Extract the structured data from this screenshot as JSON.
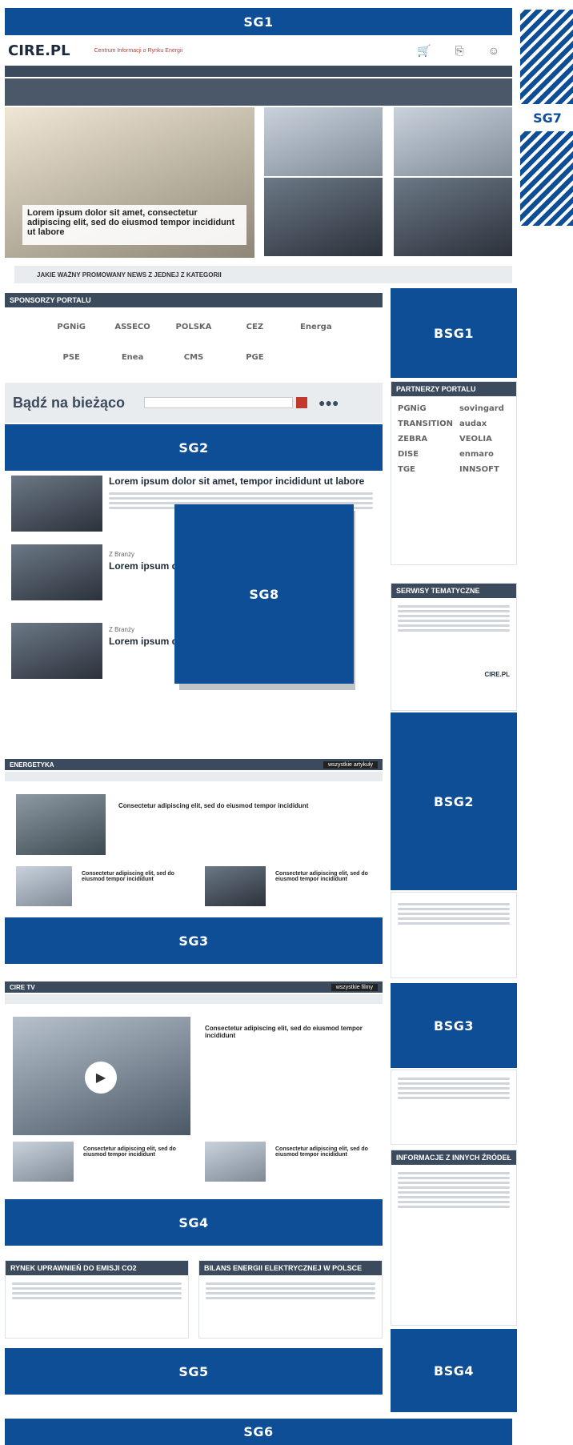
{
  "header": {
    "logo": "CIRE.PL",
    "tagline": "Centrum Informacji o Rynku Energii",
    "icons": [
      "cart-icon",
      "login-icon",
      "user-icon"
    ]
  },
  "placeholders": {
    "sg1": "SG1",
    "sg2": "SG2",
    "sg3": "SG3",
    "sg4": "SG4",
    "sg5": "SG5",
    "sg6": "SG6",
    "sg7": "SG7",
    "sg8": "SG8",
    "bsg1": "BSG1",
    "bsg2": "BSG2",
    "bsg3": "BSG3",
    "bsg4": "BSG4"
  },
  "hero": {
    "main_title": "Lorem ipsum dolor sit amet, consectetur adipiscing elit, sed do eiusmod tempor incididunt ut labore",
    "card_title": "Lorem ipsum dolor sit amet, tempor incididunt"
  },
  "banner": {
    "title": "JAKIE WAŻNY PROMOWANY NEWS Z JEDNEJ Z KATEGORII"
  },
  "sponsors": {
    "header": "SPONSORZY PORTALU",
    "logos": [
      "PGNiG",
      "ASSECO",
      "POLSKA",
      "CEZ",
      "Energa",
      "PSE",
      "Enea",
      "CMS",
      "PGE"
    ]
  },
  "newsletter": {
    "title": "Bądź na bieżąco"
  },
  "news": {
    "item1_title": "Lorem ipsum dolor sit amet, tempor incididunt ut labore",
    "item2_title": "Lorem ipsum d",
    "item3_title": "Lorem ipsum d",
    "tag": "Z Branży"
  },
  "energetyka": {
    "header": "ENERGETYKA",
    "all_link": "wszystkie artykuły",
    "lead_title": "Consectetur adipiscing elit, sed do eiusmod tempor incididunt",
    "sub_title": "Consectetur adipiscing elit, sed do eiusmod tempor incididunt"
  },
  "cire_tv": {
    "header": "CIRE TV",
    "all_link": "wszystkie filmy",
    "lead_title": "Consectetur adipiscing elit, sed do eiusmod tempor incididunt",
    "sub_title": "Consectetur adipiscing elit, sed do eiusmod tempor incididunt"
  },
  "bottom": {
    "co2_header": "RYNEK UPRAWNIEŃ DO EMISJI CO2",
    "bilans_header": "BILANS ENERGII ELEKTRYCZNEJ W POLSCE"
  },
  "sidebar": {
    "partners_header": "PARTNERZY PORTALU",
    "partners": [
      "PGNiG",
      "sovingard",
      "TRANSITION",
      "audax",
      "ZEBRA",
      "VEOLIA",
      "DISE",
      "enmaro",
      "TGE",
      "INNSOFT"
    ],
    "services_header": "SERWISY TEMATYCZNE",
    "info_header": "INFORMACJE Z INNYCH ŹRÓDEŁ",
    "brand": "CIRE.PL"
  },
  "colors": {
    "brand_blue": "#0d4e96",
    "nav_dark": "#3b4a5c"
  }
}
